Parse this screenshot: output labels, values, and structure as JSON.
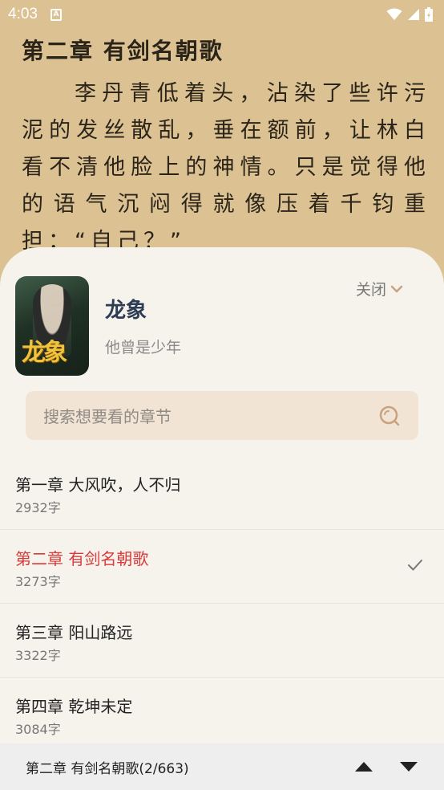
{
  "status_bar": {
    "time": "4:03",
    "notification_icon": "A"
  },
  "reader": {
    "chapter_heading": "第二章 有剑名朝歌",
    "paragraph": "李丹青低着头，沾染了些许污泥的发丝散乱，垂在额前，让林白看不清他脸上的神情。只是觉得他的语气沉闷得就像压着千钧重担：“自己？”"
  },
  "sheet": {
    "book": {
      "title": "龙象",
      "subtitle": "他曾是少年",
      "cover_text": "龙象"
    },
    "close_label": "关闭",
    "search": {
      "placeholder": "搜索想要看的章节"
    },
    "chapters": [
      {
        "title": "第一章 大风吹，人不归",
        "words": "2932字",
        "current": false
      },
      {
        "title": "第二章 有剑名朝歌",
        "words": "3273字",
        "current": true
      },
      {
        "title": "第三章 阳山路远",
        "words": "3322字",
        "current": false
      },
      {
        "title": "第四章 乾坤未定",
        "words": "3084字",
        "current": false
      }
    ],
    "bottom_bar": {
      "label": "第二章 有剑名朝歌(2/663)"
    }
  },
  "colors": {
    "page_background": "#dcc193",
    "sheet_background": "#f5f3ec",
    "search_background": "#f2e4d4",
    "current_chapter": "#d83b3b",
    "book_title": "#2e3b55",
    "search_icon": "#c9a27f"
  }
}
